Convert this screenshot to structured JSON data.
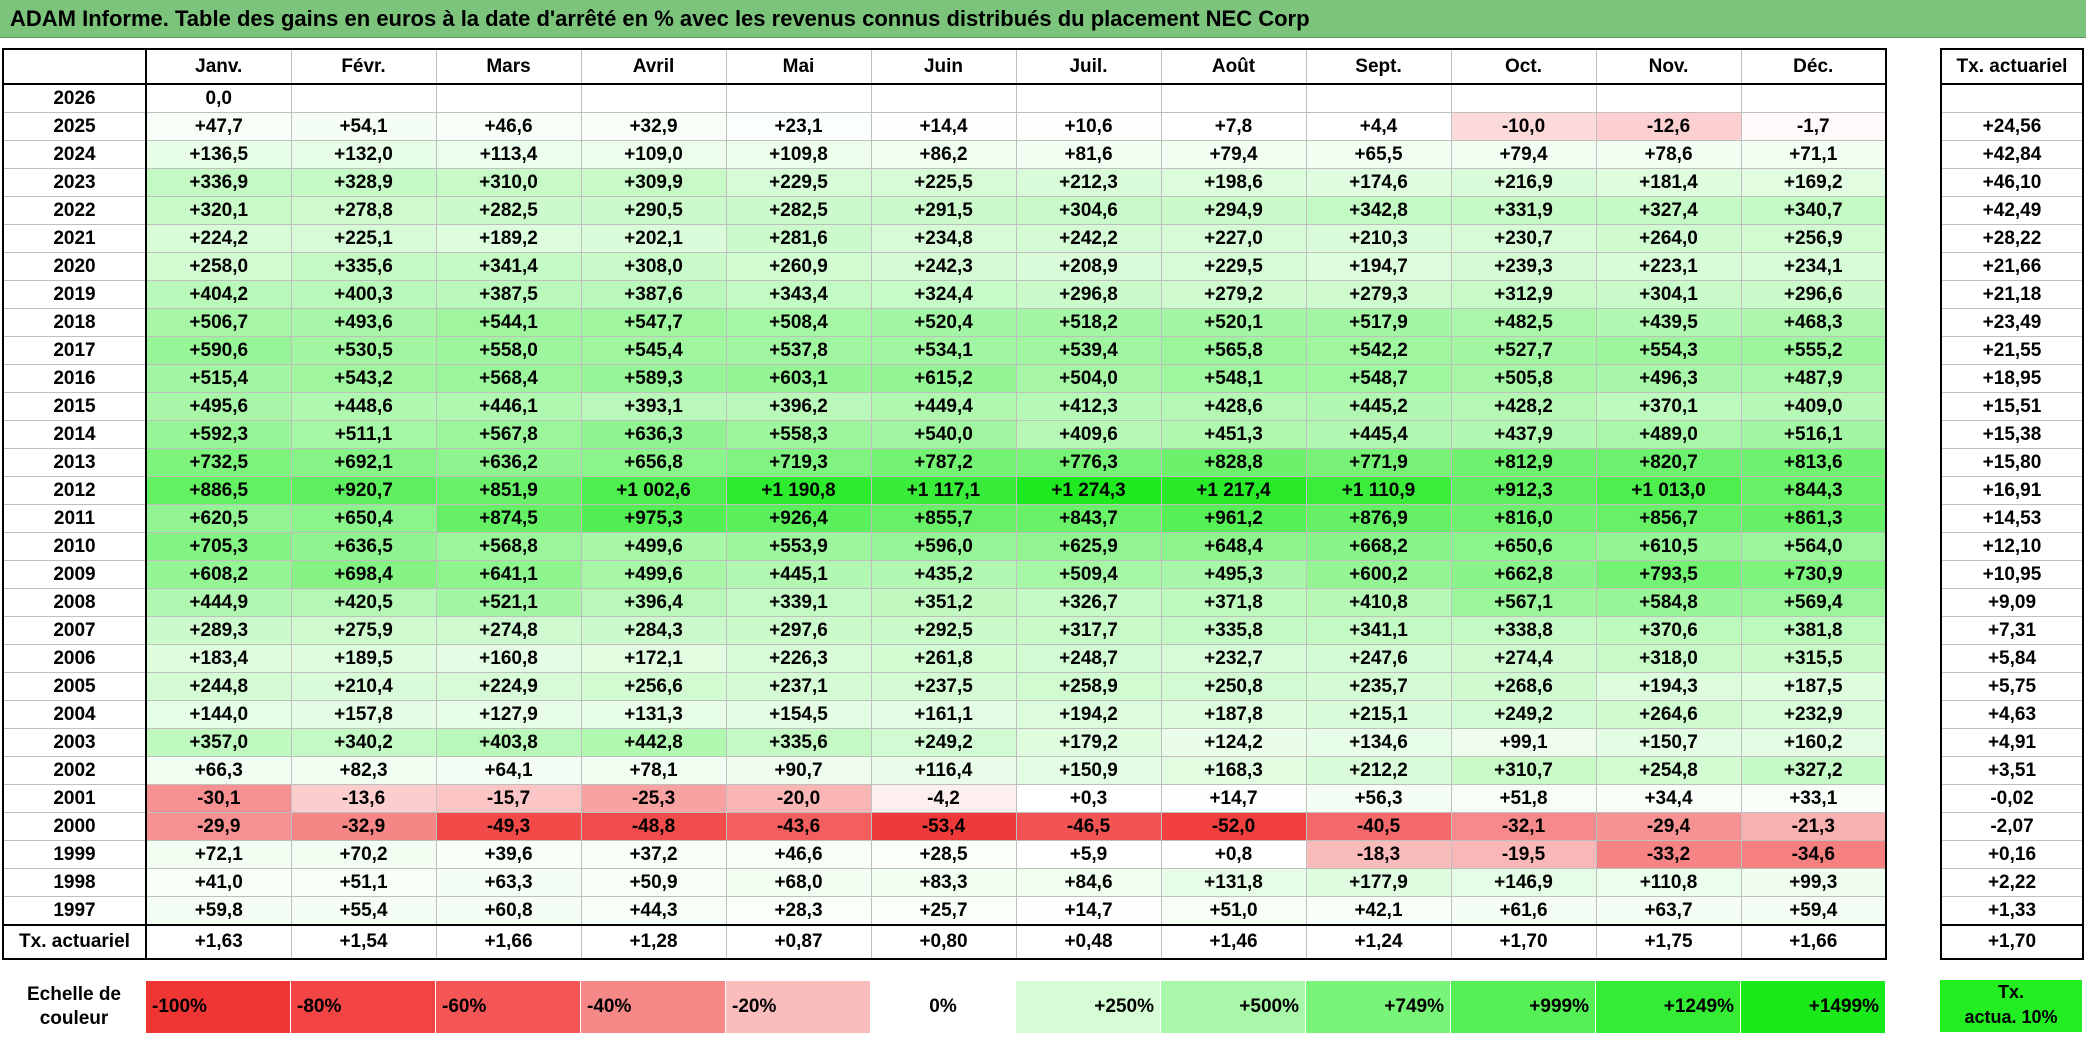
{
  "title": "ADAM Informe. Table des gains en euros à la date d'arrêté en % avec les revenus connus distribués du placement NEC Corp",
  "months": [
    "Janv.",
    "Févr.",
    "Mars",
    "Avril",
    "Mai",
    "Juin",
    "Juil.",
    "Août",
    "Sept.",
    "Oct.",
    "Nov.",
    "Déc."
  ],
  "rate_header": "Tx. actuariel",
  "rows": [
    {
      "year": "2026",
      "cells": [
        "0,0",
        "",
        "",
        "",
        "",
        "",
        "",
        "",
        "",
        "",
        "",
        ""
      ],
      "rate": ""
    },
    {
      "year": "2025",
      "cells": [
        "+47,7",
        "+54,1",
        "+46,6",
        "+32,9",
        "+23,1",
        "+14,4",
        "+10,6",
        "+7,8",
        "+4,4",
        "-10,0",
        "-12,6",
        "-1,7"
      ],
      "rate": "+24,56"
    },
    {
      "year": "2024",
      "cells": [
        "+136,5",
        "+132,0",
        "+113,4",
        "+109,0",
        "+109,8",
        "+86,2",
        "+81,6",
        "+79,4",
        "+65,5",
        "+79,4",
        "+78,6",
        "+71,1"
      ],
      "rate": "+42,84"
    },
    {
      "year": "2023",
      "cells": [
        "+336,9",
        "+328,9",
        "+310,0",
        "+309,9",
        "+229,5",
        "+225,5",
        "+212,3",
        "+198,6",
        "+174,6",
        "+216,9",
        "+181,4",
        "+169,2"
      ],
      "rate": "+46,10"
    },
    {
      "year": "2022",
      "cells": [
        "+320,1",
        "+278,8",
        "+282,5",
        "+290,5",
        "+282,5",
        "+291,5",
        "+304,6",
        "+294,9",
        "+342,8",
        "+331,9",
        "+327,4",
        "+340,7"
      ],
      "rate": "+42,49"
    },
    {
      "year": "2021",
      "cells": [
        "+224,2",
        "+225,1",
        "+189,2",
        "+202,1",
        "+281,6",
        "+234,8",
        "+242,2",
        "+227,0",
        "+210,3",
        "+230,7",
        "+264,0",
        "+256,9"
      ],
      "rate": "+28,22"
    },
    {
      "year": "2020",
      "cells": [
        "+258,0",
        "+335,6",
        "+341,4",
        "+308,0",
        "+260,9",
        "+242,3",
        "+208,9",
        "+229,5",
        "+194,7",
        "+239,3",
        "+223,1",
        "+234,1"
      ],
      "rate": "+21,66"
    },
    {
      "year": "2019",
      "cells": [
        "+404,2",
        "+400,3",
        "+387,5",
        "+387,6",
        "+343,4",
        "+324,4",
        "+296,8",
        "+279,2",
        "+279,3",
        "+312,9",
        "+304,1",
        "+296,6"
      ],
      "rate": "+21,18"
    },
    {
      "year": "2018",
      "cells": [
        "+506,7",
        "+493,6",
        "+544,1",
        "+547,7",
        "+508,4",
        "+520,4",
        "+518,2",
        "+520,1",
        "+517,9",
        "+482,5",
        "+439,5",
        "+468,3"
      ],
      "rate": "+23,49"
    },
    {
      "year": "2017",
      "cells": [
        "+590,6",
        "+530,5",
        "+558,0",
        "+545,4",
        "+537,8",
        "+534,1",
        "+539,4",
        "+565,8",
        "+542,2",
        "+527,7",
        "+554,3",
        "+555,2"
      ],
      "rate": "+21,55"
    },
    {
      "year": "2016",
      "cells": [
        "+515,4",
        "+543,2",
        "+568,4",
        "+589,3",
        "+603,1",
        "+615,2",
        "+504,0",
        "+548,1",
        "+548,7",
        "+505,8",
        "+496,3",
        "+487,9"
      ],
      "rate": "+18,95"
    },
    {
      "year": "2015",
      "cells": [
        "+495,6",
        "+448,6",
        "+446,1",
        "+393,1",
        "+396,2",
        "+449,4",
        "+412,3",
        "+428,6",
        "+445,2",
        "+428,2",
        "+370,1",
        "+409,0"
      ],
      "rate": "+15,51"
    },
    {
      "year": "2014",
      "cells": [
        "+592,3",
        "+511,1",
        "+567,8",
        "+636,3",
        "+558,3",
        "+540,0",
        "+409,6",
        "+451,3",
        "+445,4",
        "+437,9",
        "+489,0",
        "+516,1"
      ],
      "rate": "+15,38"
    },
    {
      "year": "2013",
      "cells": [
        "+732,5",
        "+692,1",
        "+636,2",
        "+656,8",
        "+719,3",
        "+787,2",
        "+776,3",
        "+828,8",
        "+771,9",
        "+812,9",
        "+820,7",
        "+813,6"
      ],
      "rate": "+15,80"
    },
    {
      "year": "2012",
      "cells": [
        "+886,5",
        "+920,7",
        "+851,9",
        "+1 002,6",
        "+1 190,8",
        "+1 117,1",
        "+1 274,3",
        "+1 217,4",
        "+1 110,9",
        "+912,3",
        "+1 013,0",
        "+844,3"
      ],
      "rate": "+16,91"
    },
    {
      "year": "2011",
      "cells": [
        "+620,5",
        "+650,4",
        "+874,5",
        "+975,3",
        "+926,4",
        "+855,7",
        "+843,7",
        "+961,2",
        "+876,9",
        "+816,0",
        "+856,7",
        "+861,3"
      ],
      "rate": "+14,53"
    },
    {
      "year": "2010",
      "cells": [
        "+705,3",
        "+636,5",
        "+568,8",
        "+499,6",
        "+553,9",
        "+596,0",
        "+625,9",
        "+648,4",
        "+668,2",
        "+650,6",
        "+610,5",
        "+564,0"
      ],
      "rate": "+12,10"
    },
    {
      "year": "2009",
      "cells": [
        "+608,2",
        "+698,4",
        "+641,1",
        "+499,6",
        "+445,1",
        "+435,2",
        "+509,4",
        "+495,3",
        "+600,2",
        "+662,8",
        "+793,5",
        "+730,9"
      ],
      "rate": "+10,95"
    },
    {
      "year": "2008",
      "cells": [
        "+444,9",
        "+420,5",
        "+521,1",
        "+396,4",
        "+339,1",
        "+351,2",
        "+326,7",
        "+371,8",
        "+410,8",
        "+567,1",
        "+584,8",
        "+569,4"
      ],
      "rate": "+9,09"
    },
    {
      "year": "2007",
      "cells": [
        "+289,3",
        "+275,9",
        "+274,8",
        "+284,3",
        "+297,6",
        "+292,5",
        "+317,7",
        "+335,8",
        "+341,1",
        "+338,8",
        "+370,6",
        "+381,8"
      ],
      "rate": "+7,31"
    },
    {
      "year": "2006",
      "cells": [
        "+183,4",
        "+189,5",
        "+160,8",
        "+172,1",
        "+226,3",
        "+261,8",
        "+248,7",
        "+232,7",
        "+247,6",
        "+274,4",
        "+318,0",
        "+315,5"
      ],
      "rate": "+5,84"
    },
    {
      "year": "2005",
      "cells": [
        "+244,8",
        "+210,4",
        "+224,9",
        "+256,6",
        "+237,1",
        "+237,5",
        "+258,9",
        "+250,8",
        "+235,7",
        "+268,6",
        "+194,3",
        "+187,5"
      ],
      "rate": "+5,75"
    },
    {
      "year": "2004",
      "cells": [
        "+144,0",
        "+157,8",
        "+127,9",
        "+131,3",
        "+154,5",
        "+161,1",
        "+194,2",
        "+187,8",
        "+215,1",
        "+249,2",
        "+264,6",
        "+232,9"
      ],
      "rate": "+4,63"
    },
    {
      "year": "2003",
      "cells": [
        "+357,0",
        "+340,2",
        "+403,8",
        "+442,8",
        "+335,6",
        "+249,2",
        "+179,2",
        "+124,2",
        "+134,6",
        "+99,1",
        "+150,7",
        "+160,2"
      ],
      "rate": "+4,91"
    },
    {
      "year": "2002",
      "cells": [
        "+66,3",
        "+82,3",
        "+64,1",
        "+78,1",
        "+90,7",
        "+116,4",
        "+150,9",
        "+168,3",
        "+212,2",
        "+310,7",
        "+254,8",
        "+327,2"
      ],
      "rate": "+3,51"
    },
    {
      "year": "2001",
      "cells": [
        "-30,1",
        "-13,6",
        "-15,7",
        "-25,3",
        "-20,0",
        "-4,2",
        "+0,3",
        "+14,7",
        "+56,3",
        "+51,8",
        "+34,4",
        "+33,1"
      ],
      "rate": "-0,02"
    },
    {
      "year": "2000",
      "cells": [
        "-29,9",
        "-32,9",
        "-49,3",
        "-48,8",
        "-43,6",
        "-53,4",
        "-46,5",
        "-52,0",
        "-40,5",
        "-32,1",
        "-29,4",
        "-21,3"
      ],
      "rate": "-2,07"
    },
    {
      "year": "1999",
      "cells": [
        "+72,1",
        "+70,2",
        "+39,6",
        "+37,2",
        "+46,6",
        "+28,5",
        "+5,9",
        "+0,8",
        "-18,3",
        "-19,5",
        "-33,2",
        "-34,6"
      ],
      "rate": "+0,16"
    },
    {
      "year": "1998",
      "cells": [
        "+41,0",
        "+51,1",
        "+63,3",
        "+50,9",
        "+68,0",
        "+83,3",
        "+84,6",
        "+131,8",
        "+177,9",
        "+146,9",
        "+110,8",
        "+99,3"
      ],
      "rate": "+2,22"
    },
    {
      "year": "1997",
      "cells": [
        "+59,8",
        "+55,4",
        "+60,8",
        "+44,3",
        "+28,3",
        "+25,7",
        "+14,7",
        "+51,0",
        "+42,1",
        "+61,6",
        "+63,7",
        "+59,4"
      ],
      "rate": "+1,33"
    }
  ],
  "totals": {
    "label": "Tx. actuariel",
    "cells": [
      "+1,63",
      "+1,54",
      "+1,66",
      "+1,28",
      "+0,87",
      "+0,80",
      "+0,48",
      "+1,46",
      "+1,24",
      "+1,70",
      "+1,75",
      "+1,66"
    ],
    "rate": "+1,70"
  },
  "legend": {
    "label_line1": "Echelle de",
    "label_line2": "couleur",
    "items": [
      {
        "text": "-100%",
        "color": "#f03535",
        "align": "left"
      },
      {
        "text": "-80%",
        "color": "#f24444",
        "align": "left"
      },
      {
        "text": "-60%",
        "color": "#f45555",
        "align": "left"
      },
      {
        "text": "-40%",
        "color": "#f78888",
        "align": "left"
      },
      {
        "text": "-20%",
        "color": "#fbbcbc",
        "align": "left"
      },
      {
        "text": "0%",
        "color": "#ffffff",
        "align": "center"
      },
      {
        "text": "+250%",
        "color": "#d6fcd6",
        "align": "right"
      },
      {
        "text": "+500%",
        "color": "#a9f7a9",
        "align": "right"
      },
      {
        "text": "+749%",
        "color": "#78f478",
        "align": "right"
      },
      {
        "text": "+999%",
        "color": "#55f055",
        "align": "right"
      },
      {
        "text": "+1249%",
        "color": "#33ec33",
        "align": "right"
      },
      {
        "text": "+1499%",
        "color": "#1ae91a",
        "align": "right"
      }
    ],
    "rate_line1": "Tx.",
    "rate_line2": "actua. 10%",
    "rate_color": "#22ee22"
  }
}
